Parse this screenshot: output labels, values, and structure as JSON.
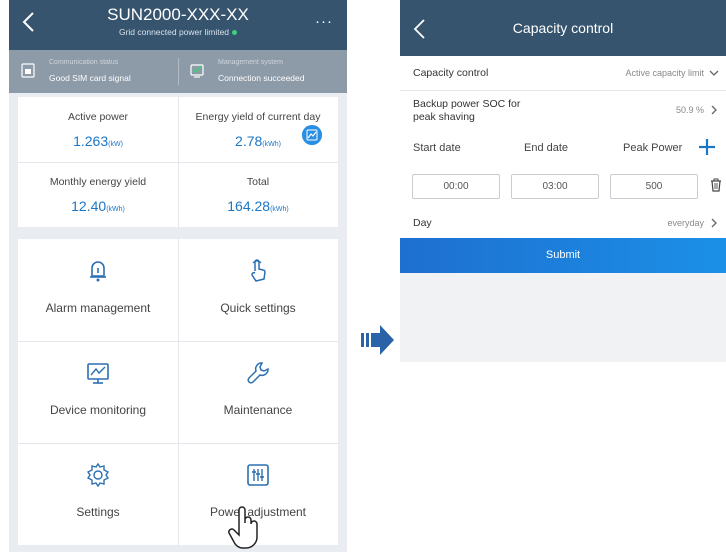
{
  "left_screen": {
    "header": {
      "title": "SUN2000-XXX-XX",
      "subtitle": "Grid connected  power limited",
      "more": "···"
    },
    "status": [
      {
        "caption": "Communication status",
        "value": "Good SIM card signal"
      },
      {
        "caption": "Management system",
        "value": "Connection succeeded"
      }
    ],
    "stats": [
      {
        "label": "Active power",
        "value": "1.263",
        "unit": "(kW)"
      },
      {
        "label": "Energy yield of current day",
        "value": "2.78",
        "unit": "(kWh)"
      },
      {
        "label": "Monthly energy yield",
        "value": "12.40",
        "unit": "(kWh)"
      },
      {
        "label": "Total",
        "value": "164.28",
        "unit": "(kWh)"
      }
    ],
    "menu": [
      {
        "label": "Alarm management",
        "icon": "bell-icon"
      },
      {
        "label": "Quick settings",
        "icon": "tap-hand-icon"
      },
      {
        "label": "Device monitoring",
        "icon": "monitor-icon"
      },
      {
        "label": "Maintenance",
        "icon": "wrench-icon"
      },
      {
        "label": "Settings",
        "icon": "gear-icon"
      },
      {
        "label": "Power adjustment",
        "icon": "sliders-icon"
      }
    ]
  },
  "right_screen": {
    "header": {
      "title": "Capacity control"
    },
    "capacity_control": {
      "label": "Capacity control",
      "value": "Active capacity limit"
    },
    "backup_soc": {
      "label_line1": "Backup power SOC for",
      "label_line2": "peak shaving",
      "value": "50.9 %"
    },
    "columns": {
      "start": "Start date",
      "end": "End date",
      "peak": "Peak Power"
    },
    "row": {
      "start": "00:00",
      "end": "03:00",
      "peak": "500"
    },
    "day": {
      "label": "Day",
      "value": "everyday"
    },
    "submit": "Submit"
  },
  "colors": {
    "header": "#36546e",
    "accent": "#1c76c6",
    "submit": "#1e7fd8",
    "status_bar": "#8d9aa8",
    "online_dot": "#3fd07a"
  }
}
